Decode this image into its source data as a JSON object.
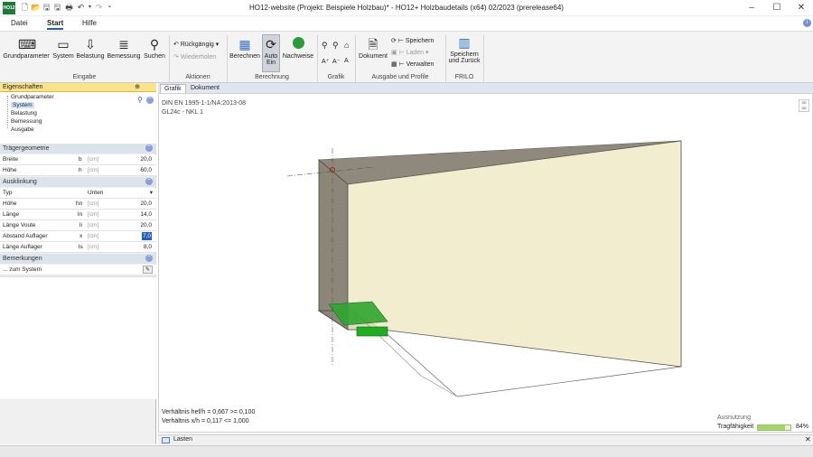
{
  "window": {
    "title": "HO12-website (Projekt: Beispiele Holzbau)* - HO12+ Holzbaudetails (x64) 02/2023 (prerelease64)",
    "app_logo": "HO12",
    "minimize": "–",
    "maximize": "☐",
    "close": "✕"
  },
  "menu": {
    "items": [
      "Datei",
      "Start",
      "Hilfe"
    ],
    "active": "Start"
  },
  "ribbon": {
    "eingabe": {
      "label": "Eingabe",
      "buttons": [
        "Grundparameter",
        "System",
        "Belastung",
        "Bemessung",
        "Suchen"
      ]
    },
    "aktionen": {
      "label": "Aktionen",
      "undo": "Rückgängig",
      "redo": "Wiederholen"
    },
    "berechnung": {
      "label": "Berechnung",
      "berechnen": "Berechnen",
      "auto_line1": "Auto",
      "auto_line2": "Ein",
      "nachweise": "Nachweise"
    },
    "grafik": {
      "label": "Grafik"
    },
    "ausgabe": {
      "label": "Ausgabe und Profile",
      "dokument": "Dokument",
      "speichern": "Speichern",
      "laden": "Laden",
      "verwalten": "Verwalten"
    },
    "frilo": {
      "label": "FRILO",
      "line1": "Speichern",
      "line2": "und Zurück"
    }
  },
  "panel": {
    "header": "Eigenschaften",
    "pin": "⊕",
    "tree": [
      "Grundparameter",
      "System",
      "Belastung",
      "Bemessung",
      "Ausgabe"
    ],
    "selected_tree": "System",
    "sections": {
      "traeger": "Trägergeometrie",
      "ausklinkung": "Ausklinkung",
      "bemerkungen": "Bemerkungen"
    },
    "traeger_rows": [
      {
        "label": "Breite",
        "sym": "b",
        "unit": "[cm]",
        "value": "20,0"
      },
      {
        "label": "Höhe",
        "sym": "h",
        "unit": "[cm]",
        "value": "60,0"
      }
    ],
    "typ": {
      "label": "Typ",
      "value": "Unten"
    },
    "ausklinkung_rows": [
      {
        "label": "Höhe",
        "sym": "hn",
        "unit": "[cm]",
        "value": "20,0"
      },
      {
        "label": "Länge",
        "sym": "ln",
        "unit": "[cm]",
        "value": "14,0"
      },
      {
        "label": "Länge Voute",
        "sym": "li",
        "unit": "[cm]",
        "value": "20,0"
      },
      {
        "label": "Abstand Auflager",
        "sym": "x",
        "unit": "[cm]",
        "value": "7,0"
      },
      {
        "label": "Länge Auflager",
        "sym": "ls",
        "unit": "[cm]",
        "value": "8,0"
      }
    ],
    "bemerkung": "... zum System"
  },
  "tabs": [
    "Grafik",
    "Dokument"
  ],
  "active_tab": "Grafik",
  "graphic": {
    "norm": "DIN EN 1995-1-1/NA:2013-08",
    "material": "GL24c - NKL 1",
    "view_toggle_top": "2D",
    "view_toggle_bottom": "3D",
    "ratio1": "Verhältnis hef/h = 0,667 >= 0,100",
    "ratio2": "Verhältnis   x/h = 0,117 <= 1,000",
    "util_title": "Ausnutzung",
    "util_label": "Tragfähigkeit",
    "util_value": "84%",
    "util_fraction": 0.84
  },
  "bottom_tab": "Lasten",
  "colors": {
    "accent": "#1f5fbf",
    "beam_fill": "#efeac6",
    "support_green": "#2fa52f"
  }
}
